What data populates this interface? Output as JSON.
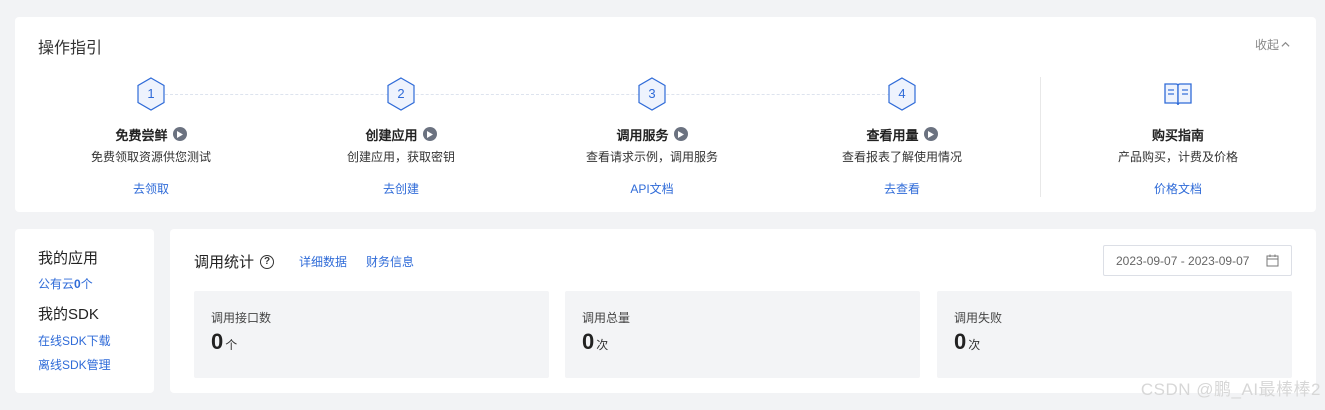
{
  "guide": {
    "title": "操作指引",
    "collapse_label": "收起",
    "steps": [
      {
        "number": "1",
        "name": "免费尝鲜",
        "desc": "免费领取资源供您测试",
        "link": "去领取"
      },
      {
        "number": "2",
        "name": "创建应用",
        "desc": "创建应用，获取密钥",
        "link": "去创建"
      },
      {
        "number": "3",
        "name": "调用服务",
        "desc": "查看请求示例，调用服务",
        "link": "API文档"
      },
      {
        "number": "4",
        "name": "查看用量",
        "desc": "查看报表了解使用情况",
        "link": "去查看"
      }
    ],
    "purchase": {
      "icon": "book-icon",
      "name": "购买指南",
      "desc": "产品购买，计费及价格",
      "link": "价格文档"
    }
  },
  "my_apps": {
    "title": "我的应用",
    "public_cloud_prefix": "公有云",
    "public_cloud_count": "0",
    "public_cloud_suffix": "个",
    "sdk_title": "我的SDK",
    "online_sdk": "在线SDK下载",
    "offline_sdk": "离线SDK管理"
  },
  "stats": {
    "title": "调用统计",
    "help_icon": "question-circle-icon",
    "tab_detail": "详细数据",
    "tab_finance": "财务信息",
    "date_range": "2023-09-07 - 2023-09-07",
    "metrics": [
      {
        "label": "调用接口数",
        "value": "0",
        "unit": "个"
      },
      {
        "label": "调用总量",
        "value": "0",
        "unit": "次"
      },
      {
        "label": "调用失败",
        "value": "0",
        "unit": "次"
      }
    ]
  },
  "watermark": "CSDN @鹏_AI最棒棒2",
  "colors": {
    "accent": "#2f6bd8",
    "background": "#f2f3f5",
    "card": "#ffffff",
    "metric_bg": "#f3f4f6"
  }
}
